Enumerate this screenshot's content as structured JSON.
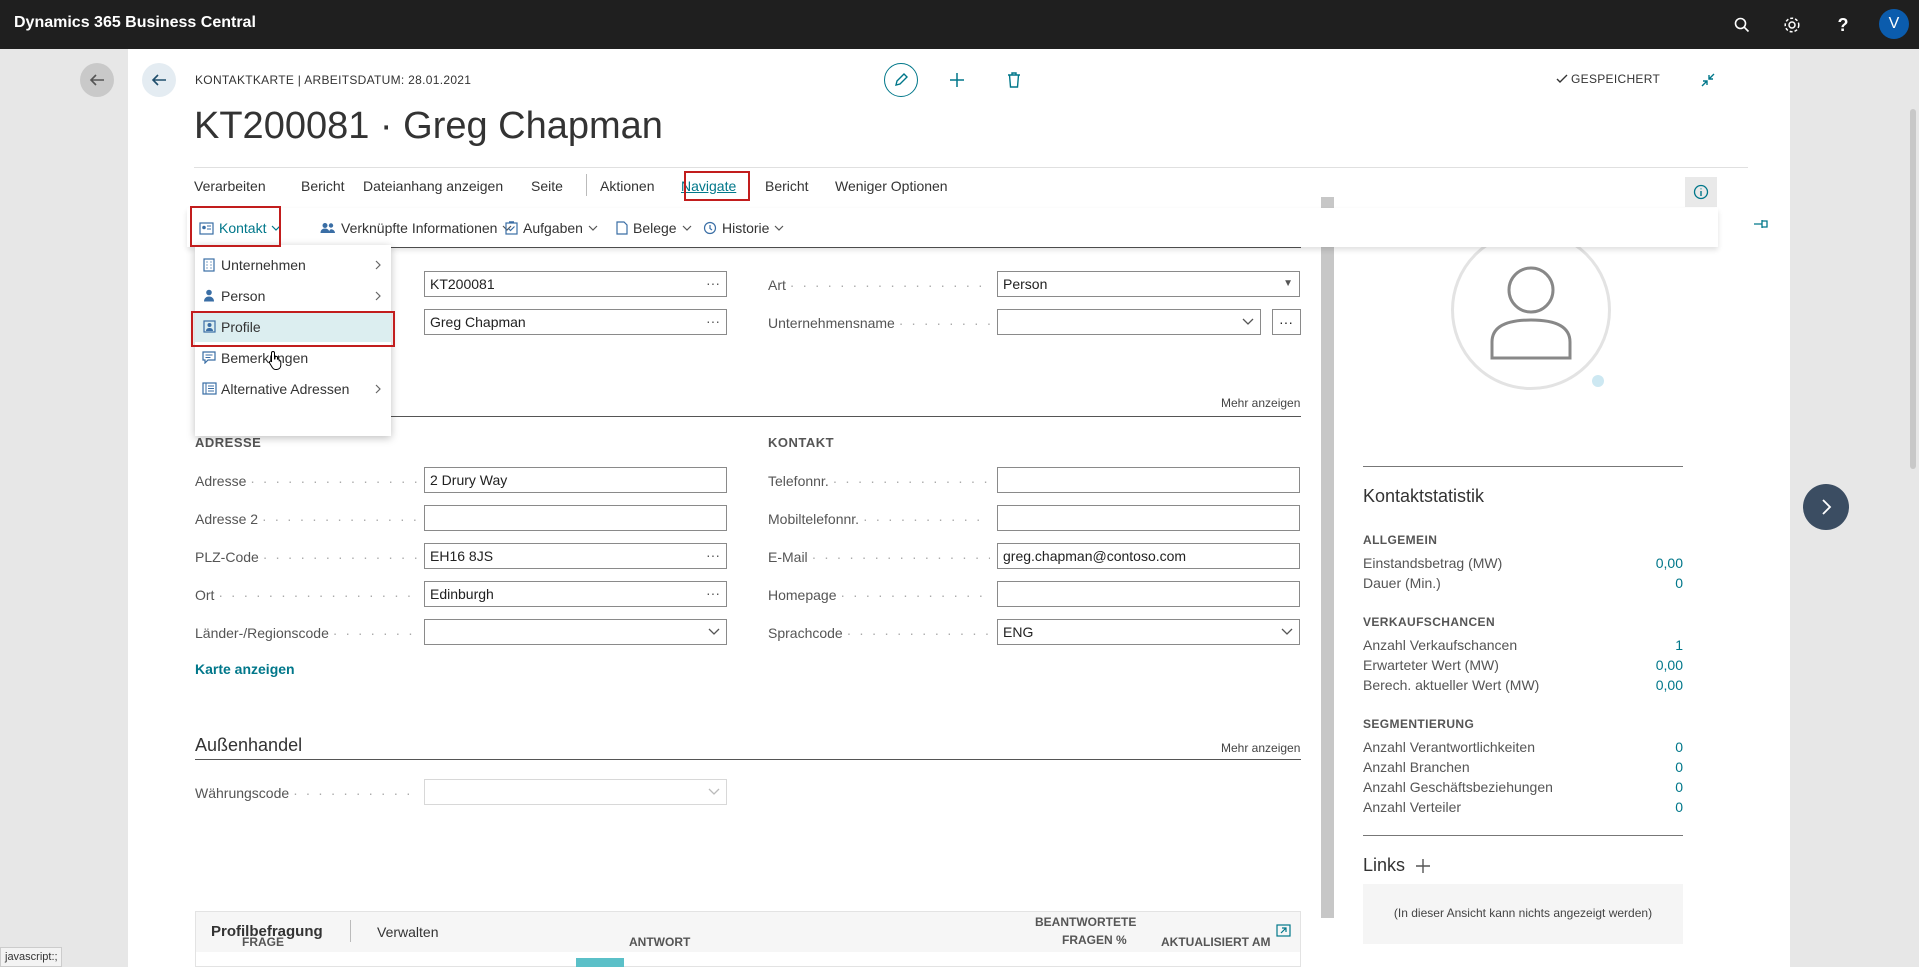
{
  "app": {
    "title": "Dynamics 365 Business Central",
    "user_initial": "V"
  },
  "header": {
    "caption": "KONTAKTKARTE | ARBEITSDATUM: 28.01.2021",
    "title": "KT200081 · Greg Chapman",
    "saved_label": "GESPEICHERT"
  },
  "actionbar": {
    "items": [
      "Verarbeiten",
      "Bericht",
      "Dateianhang anzeigen",
      "Seite",
      "Aktionen",
      "Navigate",
      "Bericht",
      "Weniger Optionen"
    ]
  },
  "subbar": {
    "items": [
      "Kontakt",
      "Verknüpfte Informationen",
      "Aufgaben",
      "Belege",
      "Historie"
    ]
  },
  "dropdown": {
    "items": [
      "Unternehmen",
      "Person",
      "Profile",
      "Bemerkungen",
      "Alternative Adressen"
    ]
  },
  "general": {
    "no_value": "KT200081",
    "name_value": "Greg Chapman",
    "art_label": "Art",
    "art_value": "Person",
    "company_label": "Unternehmensname",
    "company_value": "",
    "more": "Mehr anzeigen"
  },
  "address": {
    "header": "ADRESSE",
    "fields": [
      {
        "label": "Adresse",
        "value": "2 Drury Way"
      },
      {
        "label": "Adresse 2",
        "value": ""
      },
      {
        "label": "PLZ-Code",
        "value": "EH16 8JS"
      },
      {
        "label": "Ort",
        "value": "Edinburgh"
      },
      {
        "label": "Länder-/Regionscode",
        "value": ""
      }
    ],
    "map_link": "Karte anzeigen"
  },
  "contact": {
    "header": "KONTAKT",
    "fields": [
      {
        "label": "Telefonnr.",
        "value": ""
      },
      {
        "label": "Mobiltelefonnr.",
        "value": ""
      },
      {
        "label": "E-Mail",
        "value": "greg.chapman@contoso.com"
      },
      {
        "label": "Homepage",
        "value": ""
      },
      {
        "label": "Sprachcode",
        "value": "ENG"
      }
    ]
  },
  "foreign_trade": {
    "title": "Außenhandel",
    "more": "Mehr anzeigen",
    "currency_label": "Währungscode",
    "currency_value": ""
  },
  "profile_part": {
    "title": "Profilbefragung",
    "manage": "Verwalten",
    "columns": [
      "FRAGE",
      "ANTWORT",
      "BEANTWORTETE",
      "FRAGEN %",
      "AKTUALISIERT AM"
    ]
  },
  "factbox": {
    "title": "Kontaktstatistik",
    "sections": [
      {
        "name": "ALLGEMEIN",
        "rows": [
          {
            "label": "Einstandsbetrag (MW)",
            "value": "0,00"
          },
          {
            "label": "Dauer (Min.)",
            "value": "0"
          }
        ]
      },
      {
        "name": "VERKAUFSCHANCEN",
        "rows": [
          {
            "label": "Anzahl Verkaufschancen",
            "value": "1"
          },
          {
            "label": "Erwarteter Wert (MW)",
            "value": "0,00"
          },
          {
            "label": "Berech. aktueller Wert (MW)",
            "value": "0,00"
          }
        ]
      },
      {
        "name": "SEGMENTIERUNG",
        "rows": [
          {
            "label": "Anzahl Verantwortlichkeiten",
            "value": "0"
          },
          {
            "label": "Anzahl Branchen",
            "value": "0"
          },
          {
            "label": "Anzahl Geschäftsbeziehungen",
            "value": "0"
          },
          {
            "label": "Anzahl Verteiler",
            "value": "0"
          }
        ]
      }
    ],
    "links_title": "Links",
    "links_empty": "(In dieser Ansicht kann nichts angezeigt werden)"
  },
  "status": {
    "text": "javascript:;"
  },
  "colors": {
    "accent": "#00778a",
    "topbar": "#1f1f1f",
    "highlight_border": "#c21d1d"
  }
}
